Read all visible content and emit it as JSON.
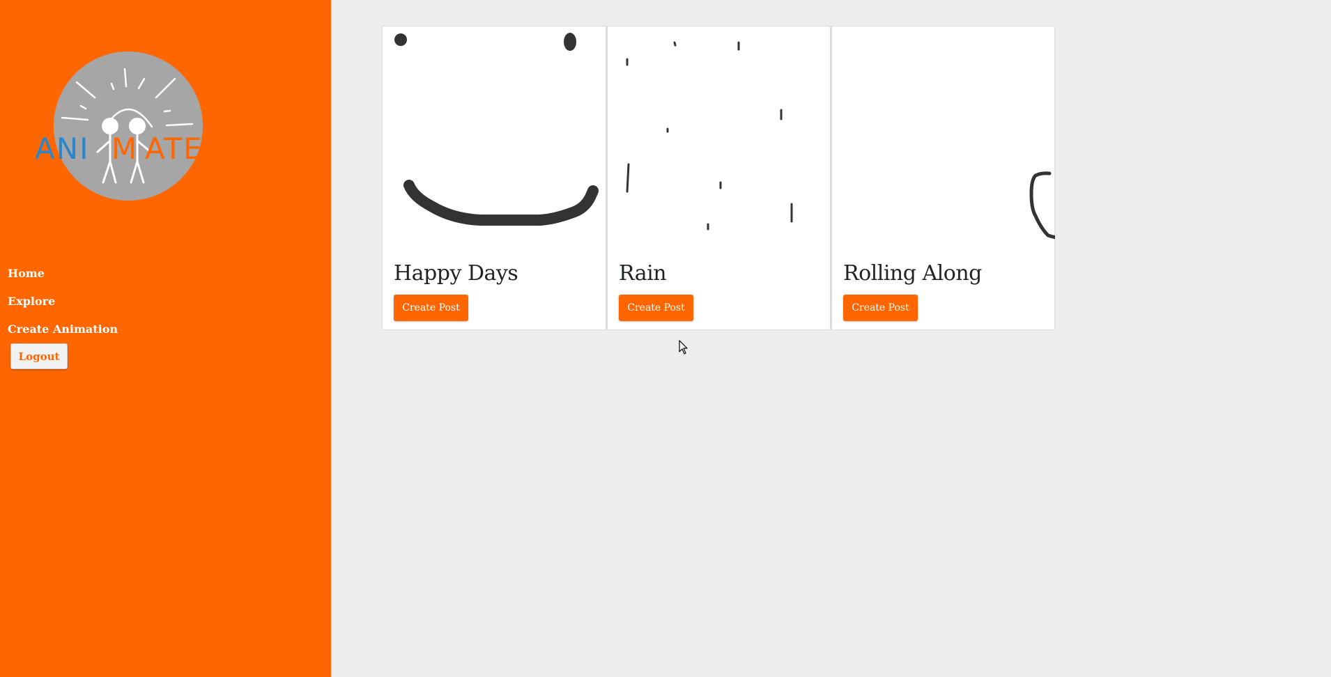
{
  "logo": {
    "text_left": "ANI",
    "text_mid": "M",
    "text_right": "ATE",
    "blue": "#2a86c8",
    "orange": "#ff6600",
    "circle_color": "#a6a6a6"
  },
  "nav": {
    "items": [
      {
        "label": "Home"
      },
      {
        "label": "Explore"
      },
      {
        "label": "Create Animation"
      }
    ],
    "logout_label": "Logout"
  },
  "cards": [
    {
      "title": "Happy Days",
      "button_label": "Create Post"
    },
    {
      "title": "Rain",
      "button_label": "Create Post"
    },
    {
      "title": "Rolling Along",
      "button_label": "Create Post"
    }
  ],
  "colors": {
    "accent": "#ff6600",
    "background": "#ededed",
    "card_background": "#ffffff",
    "ink": "#333333"
  },
  "icons": {
    "cursor": "mouse-pointer-icon"
  }
}
